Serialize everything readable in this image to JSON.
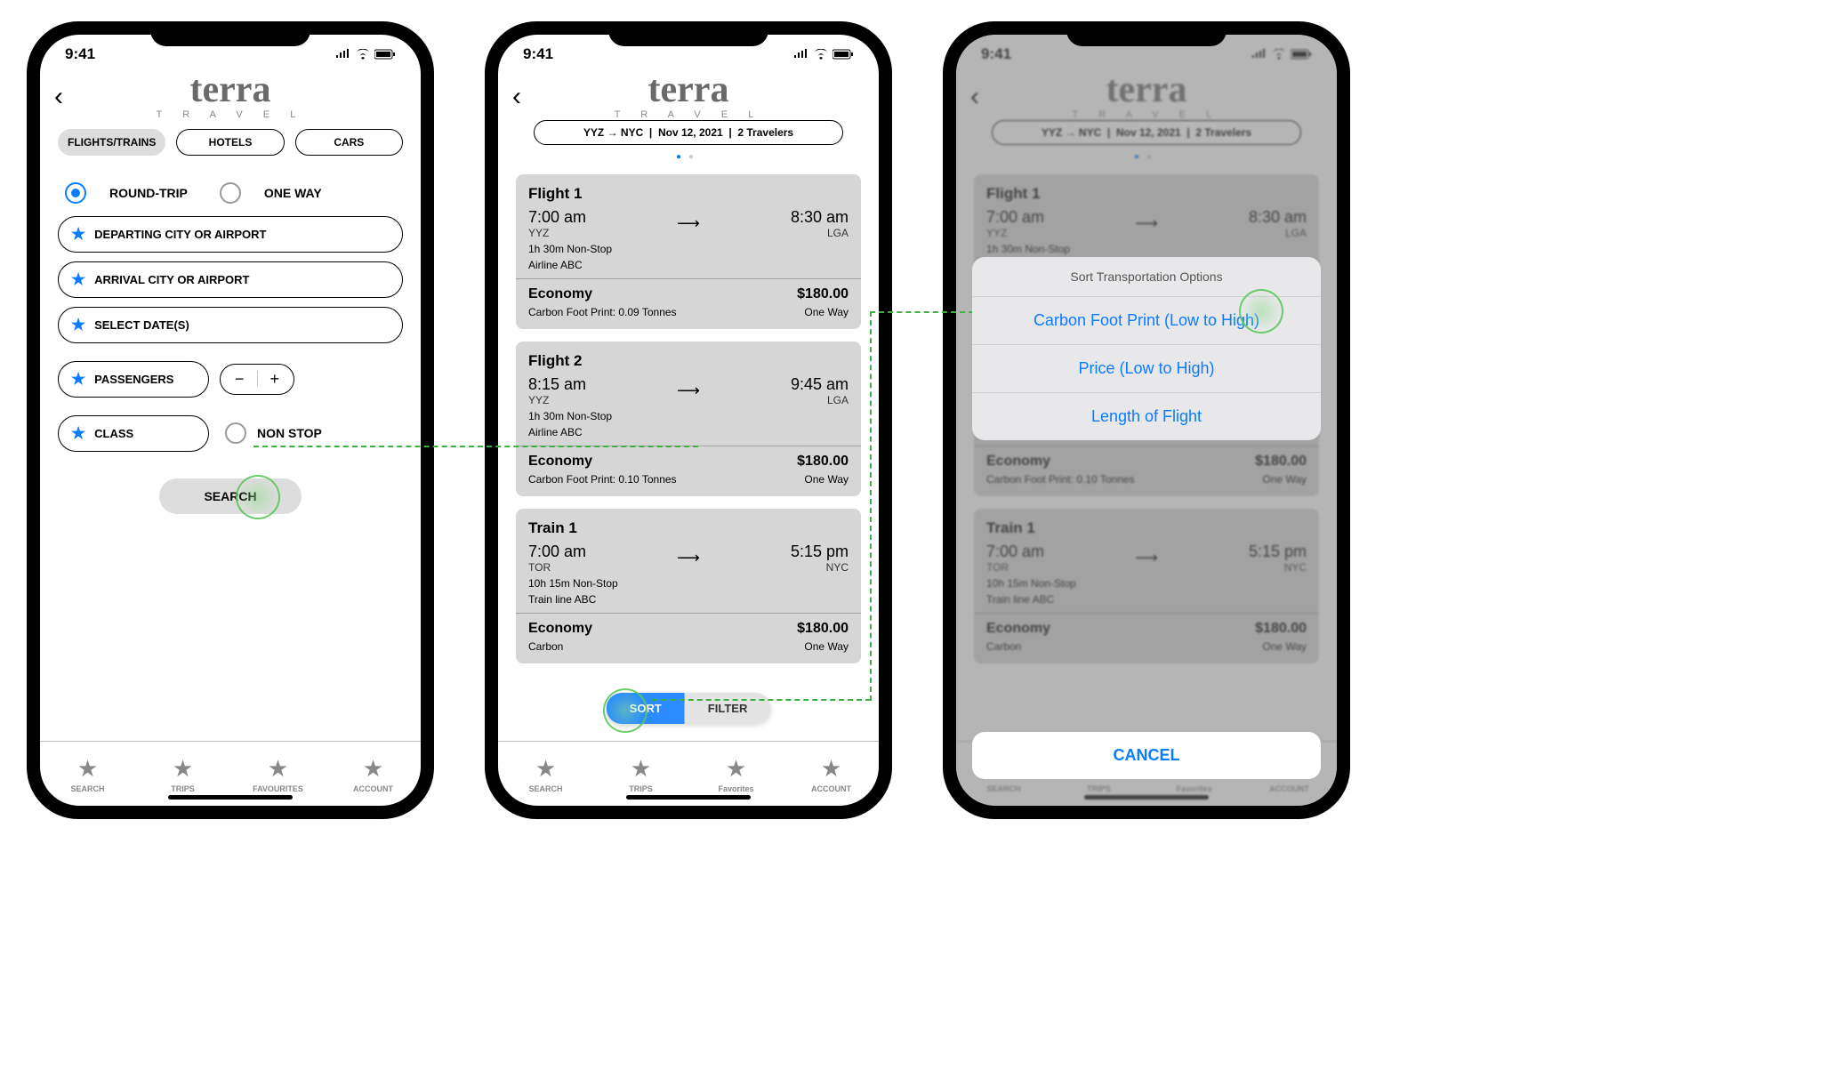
{
  "status": {
    "time": "9:41"
  },
  "brand": {
    "name": "terra",
    "sub": "T R A V E L"
  },
  "tabs": {
    "flights": "FLIGHTS/TRAINS",
    "hotels": "HOTELS",
    "cars": "CARS"
  },
  "trip": {
    "round": "ROUND-TRIP",
    "oneway": "ONE WAY"
  },
  "fields": {
    "depart": "DEPARTING CITY OR AIRPORT",
    "arrive": "ARRIVAL CITY OR AIRPORT",
    "dates": "SELECT DATE(S)",
    "pax": "PASSENGERS",
    "class": "CLASS",
    "nonstop": "NON STOP"
  },
  "search_label": "SEARCH",
  "nav": {
    "search": "SEARCH",
    "trips": "TRIPS",
    "favourites": "FAVOURITES",
    "favorites_alt": "Favorites",
    "account": "ACCOUNT"
  },
  "summary": {
    "route": "YYZ → NYC",
    "date": "Nov 12, 2021",
    "pax": "2 Travelers"
  },
  "results": [
    {
      "title": "Flight 1",
      "dep_time": "7:00 am",
      "dep_code": "YYZ",
      "arr_time": "8:30 am",
      "arr_code": "LGA",
      "dur": "1h 30m Non-Stop",
      "carrier": "Airline ABC",
      "class": "Economy",
      "price": "$180.00",
      "foot": "Carbon Foot Print: 0.09 Tonnes",
      "way": "One Way"
    },
    {
      "title": "Flight 2",
      "dep_time": "8:15 am",
      "dep_code": "YYZ",
      "arr_time": "9:45 am",
      "arr_code": "LGA",
      "dur": "1h 30m Non-Stop",
      "carrier": "Airline ABC",
      "class": "Economy",
      "price": "$180.00",
      "foot": "Carbon Foot Print: 0.10 Tonnes",
      "way": "One Way"
    },
    {
      "title": "Train 1",
      "dep_time": "7:00 am",
      "dep_code": "TOR",
      "arr_time": "5:15 pm",
      "arr_code": "NYC",
      "dur": "10h 15m Non-Stop",
      "carrier": "Train line ABC",
      "class": "Economy",
      "price": "$180.00",
      "foot": "Carbon",
      "way": "One Way"
    }
  ],
  "sortfilter": {
    "sort": "SORT",
    "filter": "FILTER"
  },
  "sheet": {
    "title": "Sort Transportation Options",
    "opt1": "Carbon Foot Print (Low to High)",
    "opt2": "Price (Low to High)",
    "opt3": "Length of Flight",
    "cancel": "CANCEL"
  }
}
